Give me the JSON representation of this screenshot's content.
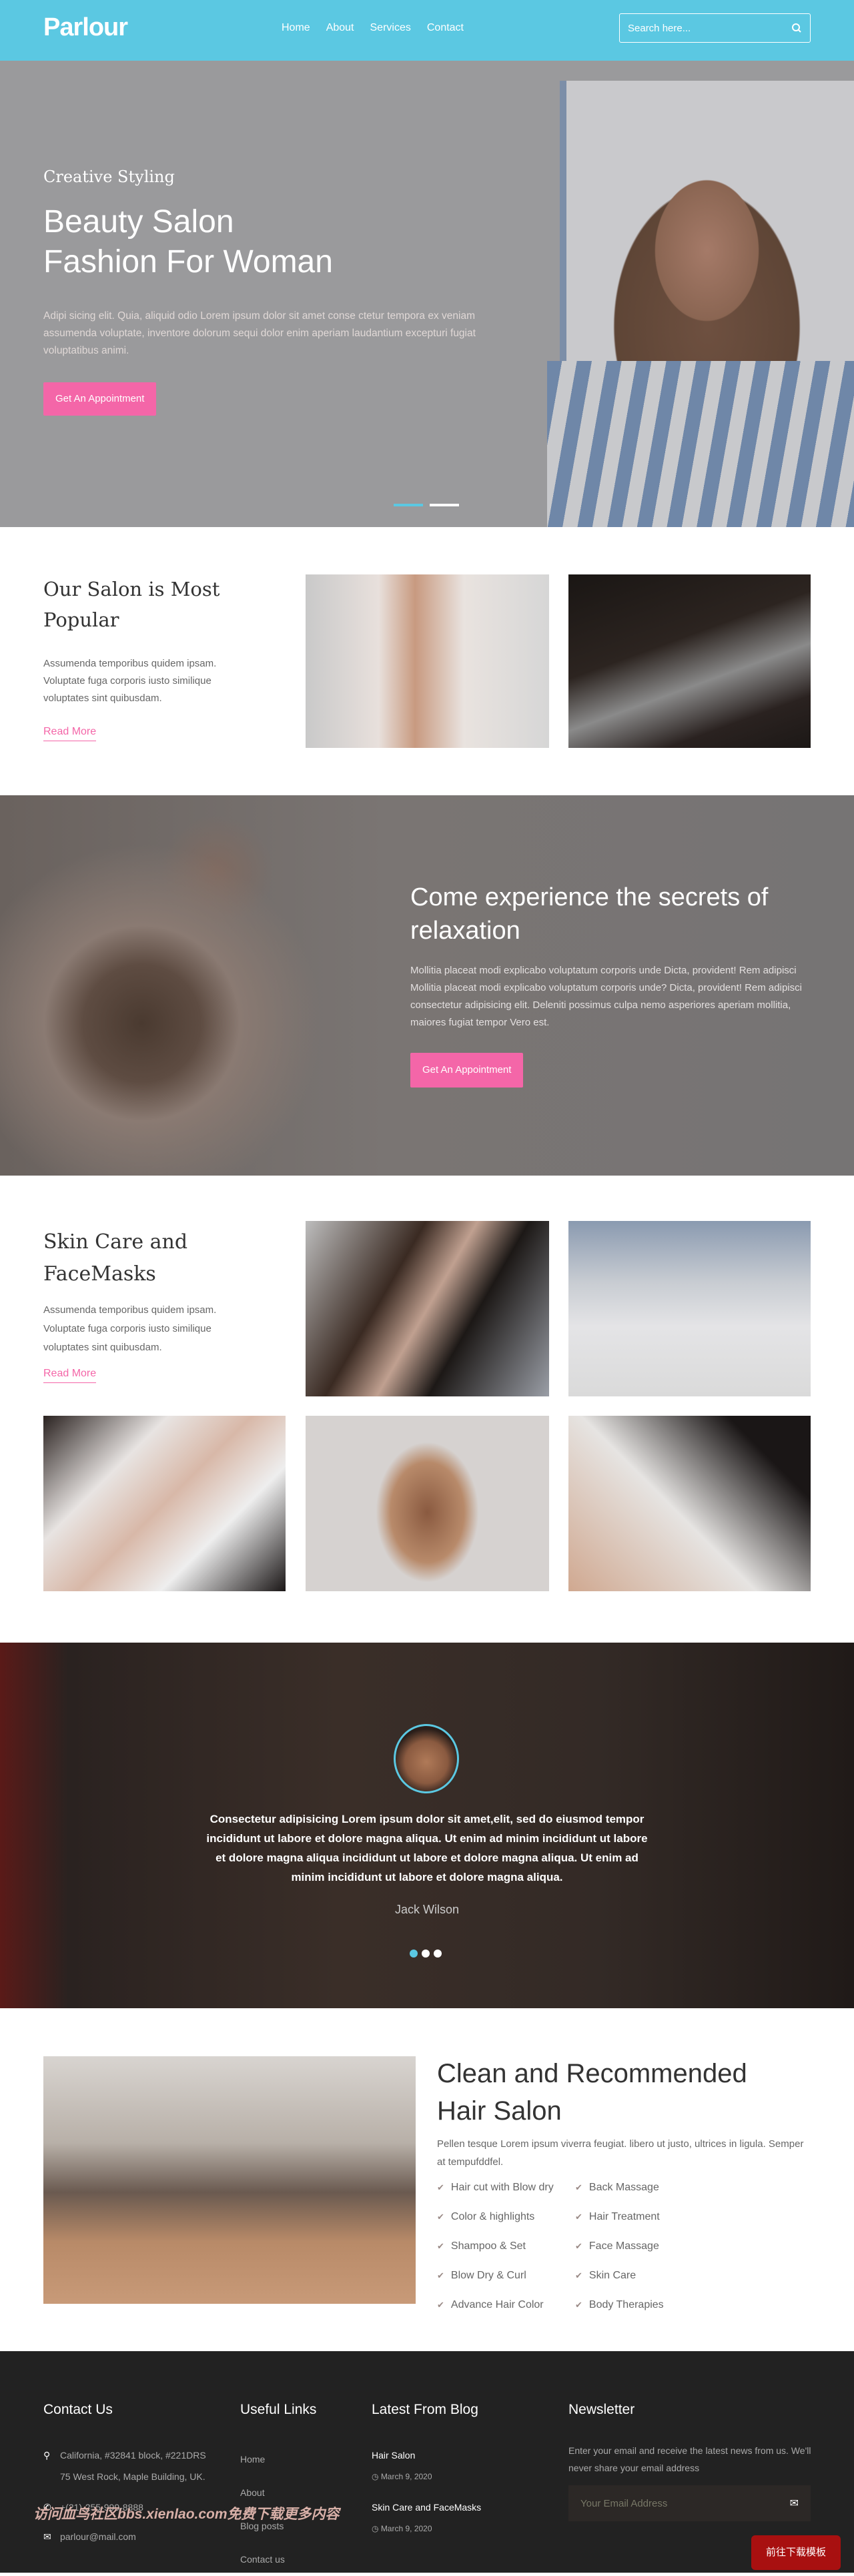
{
  "nav": {
    "logo": "Parlour",
    "links": [
      "Home",
      "About",
      "Services",
      "Contact"
    ],
    "search_placeholder": "Search here..."
  },
  "hero": {
    "kicker": "Creative Styling",
    "title_line1": "Beauty Salon",
    "title_line2": "Fashion For Woman",
    "text": "Adipi sicing elit. Quia, aliquid odio Lorem ipsum dolor sit amet conse ctetur tempora ex veniam assumenda voluptate, inventore dolorum sequi dolor enim aperiam laudantium excepturi fugiat voluptatibus animi.",
    "button": "Get An Appointment",
    "slides": 2,
    "active_slide": 1
  },
  "popular": {
    "title": "Our Salon is Most Popular",
    "text": "Assumenda temporibus quidem ipsam. Voluptate fuga corporis iusto similique voluptates sint quibusdam.",
    "link": "Read More"
  },
  "relax": {
    "title": "Come experience the secrets of relaxation",
    "text": "Mollitia placeat modi explicabo voluptatum corporis unde Dicta, provident! Rem adipisci Mollitia placeat modi explicabo voluptatum corporis unde? Dicta, provident! Rem adipisci consectetur adipisicing elit. Deleniti possimus culpa nemo asperiores aperiam mollitia, maiores fugiat tempor Vero est.",
    "button": "Get An Appointment"
  },
  "skincare": {
    "title_line1": "Skin Care and",
    "title_line2": "FaceMasks",
    "text": "Assumenda temporibus quidem ipsam. Voluptate fuga corporis iusto similique voluptates sint quibusdam.",
    "link": "Read More"
  },
  "testimonial": {
    "quote": "Consectetur adipisicing Lorem ipsum dolor sit amet,elit, sed do eiusmod tempor incididunt ut labore et dolore magna aliqua. Ut enim ad minim incididunt ut labore et dolore magna aliqua incididunt ut labore et dolore magna aliqua. Ut enim ad minim incididunt ut labore et dolore magna aliqua.",
    "name": "Jack Wilson",
    "slides": 3,
    "active_slide": 1
  },
  "clean": {
    "title_line1": "Clean and Recommended",
    "title_line2": "Hair Salon",
    "text": "Pellen tesque Lorem ipsum viverra feugiat. libero ut justo, ultrices in ligula. Semper at tempufddfel.",
    "services": [
      "Hair cut with Blow dry",
      "Back Massage",
      "Color & highlights",
      "Hair Treatment",
      "Shampoo & Set",
      "Face Massage",
      "Blow Dry & Curl",
      "Skin Care",
      "Advance Hair Color",
      "Body Therapies"
    ]
  },
  "footer": {
    "contact_title": "Contact Us",
    "address": "California, #32841 block, #221DRS 75 West Rock, Maple Building, UK.",
    "phone": "+(21)-255-999-8888",
    "email": "parlour@mail.com",
    "links_title": "Useful Links",
    "links": [
      "Home",
      "About",
      "Blog posts",
      "Contact us"
    ],
    "blog_title": "Latest From Blog",
    "posts": [
      {
        "title": "Hair Salon",
        "date": "March 9, 2020"
      },
      {
        "title": "Skin Care and FaceMasks",
        "date": "March 9, 2020"
      }
    ],
    "newsletter_title": "Newsletter",
    "newsletter_text": "Enter your email and receive the latest news from us. We'll never share your email address",
    "email_placeholder": "Your Email Address"
  },
  "overlay": {
    "download_button": "前往下载模板",
    "watermark": "访问血鸟社区bbs.xienlao.com免费下载更多内容"
  },
  "colors": {
    "accent": "#5bc8e2",
    "pink": "#f466a8",
    "footer_bg": "#222222"
  }
}
